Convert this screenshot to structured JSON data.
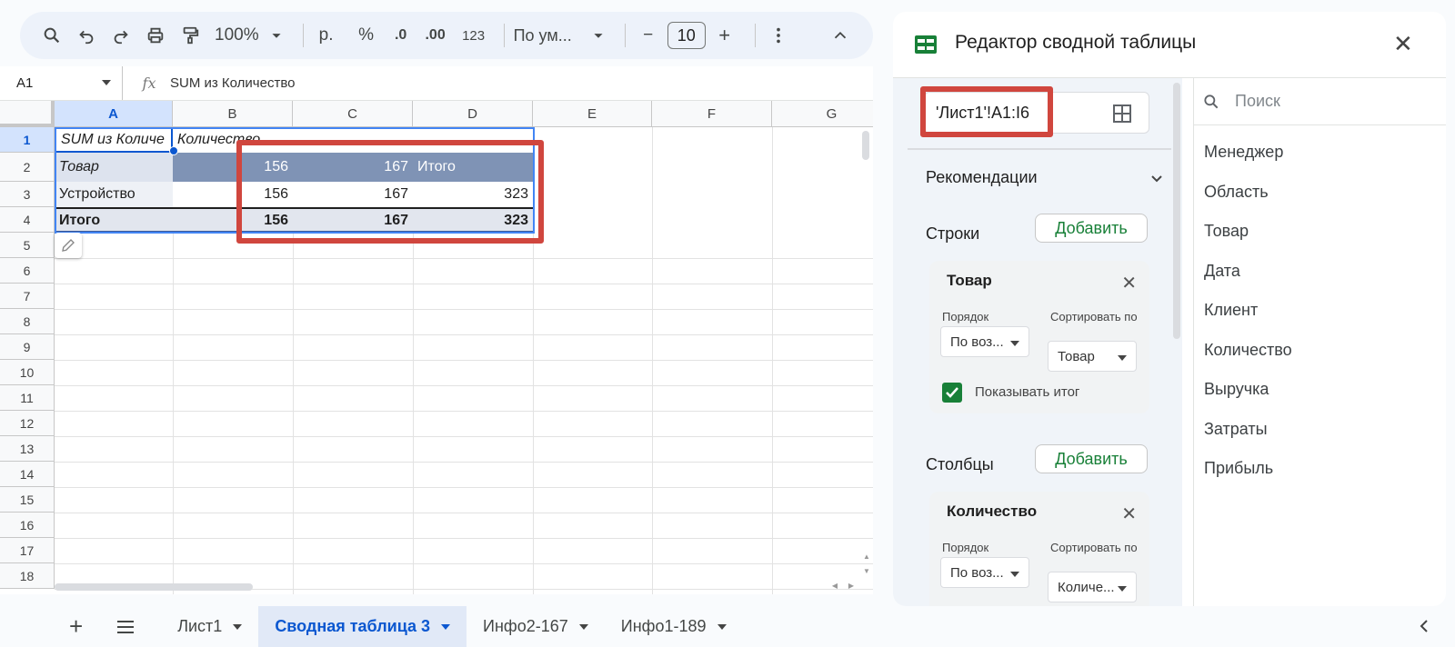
{
  "toolbar": {
    "zoom": "100%",
    "currency": "р.",
    "percent": "%",
    "decrease_decimal": ".0",
    "increase_decimal": ".00",
    "number_format": "123",
    "font": "По ум...",
    "font_size": "10",
    "minus": "−",
    "plus": "+"
  },
  "formula_bar": {
    "cell_ref": "A1",
    "fx": "fx",
    "value": "SUM из Количество"
  },
  "grid": {
    "columns": [
      "A",
      "B",
      "C",
      "D",
      "E",
      "F",
      "G"
    ],
    "rows": [
      "1",
      "2",
      "3",
      "4",
      "5",
      "6",
      "7",
      "8",
      "9",
      "10",
      "11",
      "12",
      "13",
      "14",
      "15",
      "16",
      "17",
      "18"
    ],
    "r1": {
      "a": "SUM из Количе",
      "b": "Количество"
    },
    "r2": {
      "a": "Товар",
      "b": "156",
      "c": "167",
      "d": "Итого"
    },
    "r3": {
      "a": "Устройство",
      "b": "156",
      "c": "167",
      "d": "323"
    },
    "r4": {
      "a": "Итого",
      "b": "156",
      "c": "167",
      "d": "323"
    }
  },
  "panel": {
    "title": "Редактор сводной таблицы",
    "range": "'Лист1'!A1:I6",
    "search_placeholder": "Поиск",
    "recommendations": "Рекомендации",
    "rows_label": "Строки",
    "columns_label": "Столбцы",
    "add": "Добавить",
    "card_rows": {
      "title": "Товар",
      "order_label": "Порядок",
      "order_value": "По воз...",
      "sort_label": "Сортировать по",
      "sort_value": "Товар",
      "show_total": "Показывать итог"
    },
    "card_cols": {
      "title": "Количество",
      "order_label": "Порядок",
      "order_value": "По воз...",
      "sort_label": "Сортировать по",
      "sort_value": "Количе..."
    },
    "fields": [
      "Менеджер",
      "Область",
      "Товар",
      "Дата",
      "Клиент",
      "Количество",
      "Выручка",
      "Затраты",
      "Прибыль"
    ]
  },
  "sheet_tabs": {
    "tabs": [
      "Лист1",
      "Сводная таблица 3",
      "Инфо2-167",
      "Инфо1-189"
    ]
  },
  "colors": {
    "pivot_header_bg": "#7f93b5",
    "pivot_total_bg": "#e2e6ee",
    "highlight_red": "#d0463e",
    "accent_blue": "#0b57d0",
    "green": "#188038"
  }
}
